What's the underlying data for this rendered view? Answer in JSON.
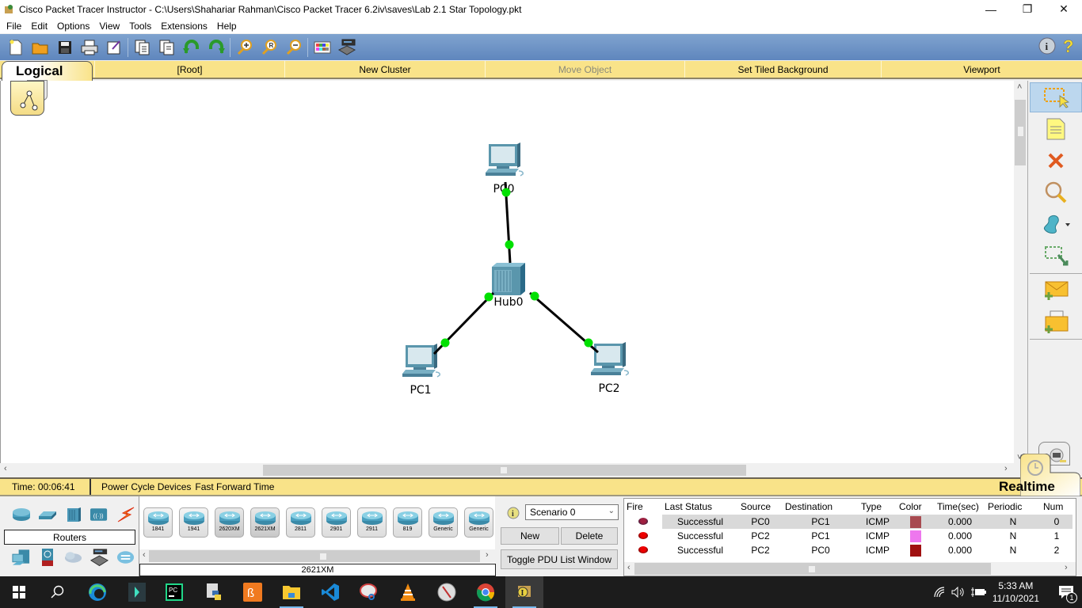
{
  "window": {
    "title": "Cisco Packet Tracer Instructor - C:\\Users\\Shahariar Rahman\\Cisco Packet Tracer 6.2iv\\saves\\Lab 2.1 Star Topology.pkt",
    "minimize": "—",
    "maximize": "❐",
    "close": "✕"
  },
  "menu": [
    "File",
    "Edit",
    "Options",
    "View",
    "Tools",
    "Extensions",
    "Help"
  ],
  "toolbar": {
    "buttons": [
      "new-icon",
      "open-icon",
      "save-icon",
      "print-icon",
      "activity-wizard-icon",
      "copy-icon",
      "paste-icon",
      "undo-icon",
      "redo-icon",
      "zoom-in-icon",
      "zoom-reset-icon",
      "zoom-out-icon",
      "palette-icon",
      "custom-device-icon"
    ],
    "right": [
      "info-icon",
      "help-icon"
    ]
  },
  "workspace_bar": {
    "mode": "Logical",
    "items": [
      {
        "label": "[Root]",
        "enabled": true
      },
      {
        "label": "New Cluster",
        "enabled": true
      },
      {
        "label": "Move Object",
        "enabled": false
      },
      {
        "label": "Set Tiled Background",
        "enabled": true
      },
      {
        "label": "Viewport",
        "enabled": true
      }
    ]
  },
  "topology": {
    "devices": [
      {
        "name": "PC0",
        "type": "pc"
      },
      {
        "name": "Hub0",
        "type": "hub"
      },
      {
        "name": "PC1",
        "type": "pc"
      },
      {
        "name": "PC2",
        "type": "pc"
      }
    ],
    "links": [
      {
        "from": "PC0",
        "to": "Hub0",
        "status": "up",
        "link_color": "#00e000"
      },
      {
        "from": "PC1",
        "to": "Hub0",
        "status": "up",
        "link_color": "#00e000"
      },
      {
        "from": "PC2",
        "to": "Hub0",
        "status": "up",
        "link_color": "#00e000"
      }
    ]
  },
  "palette": [
    "select-icon",
    "note-icon",
    "delete-icon",
    "inspect-icon",
    "draw-shape-icon",
    "resize-icon",
    "add-simple-pdu-icon",
    "add-complex-pdu-icon"
  ],
  "realtime_bar": {
    "time": "Time: 00:06:41",
    "power_cycle": "Power Cycle Devices",
    "fast_forward": "Fast Forward Time",
    "mode": "Realtime"
  },
  "device_categories": {
    "selected": "Routers",
    "row1": [
      "routers-icon",
      "switches-icon",
      "hubs-icon",
      "wireless-icon",
      "connections-icon"
    ],
    "row2": [
      "end-devices-icon",
      "security-icon",
      "wan-emulation-icon",
      "custom-devices-icon",
      "multiuser-icon"
    ]
  },
  "device_list": {
    "items": [
      "1841",
      "1941",
      "2620XM",
      "2621XM",
      "2811",
      "2901",
      "2911",
      "819",
      "Generic",
      "Generic"
    ],
    "selected": "2621XM"
  },
  "scenario": {
    "selected": "Scenario 0",
    "new": "New",
    "delete": "Delete",
    "toggle": "Toggle PDU List Window"
  },
  "pdu_table": {
    "headers": [
      "Fire",
      "Last Status",
      "Source",
      "Destination",
      "Type",
      "Color",
      "Time(sec)",
      "Periodic",
      "Num"
    ],
    "rows": [
      {
        "status": "Successful",
        "source": "PC0",
        "destination": "PC1",
        "type": "ICMP",
        "color": "#a84a50",
        "time": "0.000",
        "periodic": "N",
        "num": "0"
      },
      {
        "status": "Successful",
        "source": "PC2",
        "destination": "PC1",
        "type": "ICMP",
        "color": "#ee77ee",
        "time": "0.000",
        "periodic": "N",
        "num": "1"
      },
      {
        "status": "Successful",
        "source": "PC2",
        "destination": "PC0",
        "type": "ICMP",
        "color": "#a01010",
        "time": "0.000",
        "periodic": "N",
        "num": "2"
      }
    ]
  },
  "taskbar": {
    "apps": [
      "start-icon",
      "search-icon",
      "edge-icon",
      "filmora-icon",
      "pycharm-icon",
      "python-idle-icon",
      "xampp-icon",
      "file-explorer-icon",
      "vscode-icon",
      "snipping-tool-icon",
      "vlc-icon",
      "compass-icon",
      "chrome-icon",
      "packet-tracer-icon"
    ],
    "time": "5:33 AM",
    "date": "11/10/2021",
    "notifications": "1"
  }
}
